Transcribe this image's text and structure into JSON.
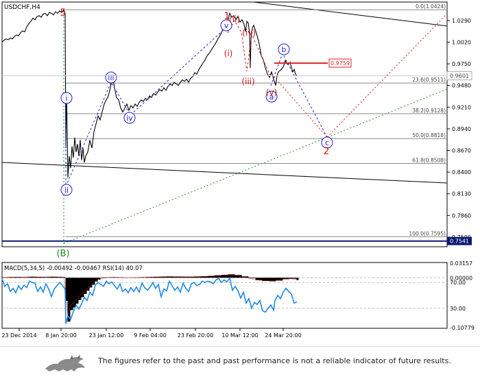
{
  "header": {
    "symbol_label": "USDCHF,H4"
  },
  "indicator": {
    "label": "MACD(5,34,5) -0.00492 -0.00467 RSI(14) 40.07"
  },
  "disclaimer": "The figures refer to the past and past performance is not a reliable indicator of future results.",
  "colors": {
    "price_line": "#000000",
    "wave_blue": "#1f1fcc",
    "wave_red": "#cc1414",
    "wave_green": "#228822",
    "level_line": "#888888",
    "current_price_bg": "#0a1a70",
    "target_line": "#e02020",
    "rsi_line": "#1e88e5",
    "histogram": "#000000"
  },
  "chart_data": {
    "type": "line",
    "symbol": "USDCHF",
    "timeframe": "H4",
    "x_labels": [
      "23 Dec 2014",
      "8 Jan 20:00",
      "23 Jan 12:00",
      "9 Feb 04:00",
      "23 Feb 20:00",
      "10 Mar 12:00",
      "24 Mar 20:00"
    ],
    "y_ticks": [
      "1.0290",
      "1.0020",
      "0.9750",
      "0.9480",
      "0.9210",
      "0.8940",
      "0.8670",
      "0.8400",
      "0.8130",
      "0.7860",
      "0.7590"
    ],
    "ylim": [
      0.747,
      1.052
    ],
    "current_price": "0.9601",
    "base_level": "0.7541",
    "target_label": "0.9759",
    "fib_levels": [
      {
        "label": "0.0(1.0424)",
        "price": 1.0424
      },
      {
        "label": "23.6(0.9511)",
        "price": 0.9511
      },
      {
        "label": "38.2(0.9128)",
        "price": 0.9128
      },
      {
        "label": "50.0(0.8818)",
        "price": 0.8818
      },
      {
        "label": "61.8(0.8508)",
        "price": 0.8508
      },
      {
        "label": "100.0(0.7595)",
        "price": 0.7595
      }
    ],
    "wave_labels_blue": [
      "i",
      "ii",
      "iii",
      "iv",
      "v",
      "b",
      "c",
      "a"
    ],
    "wave_labels_red": [
      "5",
      "1",
      "(ii)",
      "(iv)",
      "(i)",
      "(iii)",
      "(v)",
      "2"
    ],
    "wave_labels_green": [
      "(B)"
    ],
    "price_series": [
      [
        0,
        1.0021
      ],
      [
        3,
        1.0045
      ],
      [
        6,
        1.006
      ],
      [
        9,
        1.005
      ],
      [
        12,
        1.0072
      ],
      [
        15,
        1.006
      ],
      [
        18,
        1.009
      ],
      [
        21,
        1.011
      ],
      [
        24,
        1.0098
      ],
      [
        27,
        1.014
      ],
      [
        30,
        1.016
      ],
      [
        33,
        1.015
      ],
      [
        36,
        1.021
      ],
      [
        39,
        1.025
      ],
      [
        42,
        1.028
      ],
      [
        45,
        1.032
      ],
      [
        48,
        1.03
      ],
      [
        51,
        1.034
      ],
      [
        54,
        1.035
      ],
      [
        57,
        1.033
      ],
      [
        60,
        1.037
      ],
      [
        63,
        1.038
      ],
      [
        66,
        1.035
      ],
      [
        69,
        1.039
      ],
      [
        72,
        1.038
      ],
      [
        75,
        1.036
      ],
      [
        78,
        1.04
      ],
      [
        81,
        1.038
      ],
      [
        84,
        1.041
      ],
      [
        87,
        1.039
      ],
      [
        90,
        1.0424
      ],
      [
        92,
        1.038
      ],
      [
        93,
        0.87
      ],
      [
        94,
        0.94
      ],
      [
        95,
        0.89
      ],
      [
        96,
        0.833
      ],
      [
        98,
        0.86
      ],
      [
        100,
        0.845
      ],
      [
        102,
        0.872
      ],
      [
        104,
        0.858
      ],
      [
        106,
        0.883
      ],
      [
        108,
        0.865
      ],
      [
        110,
        0.875
      ],
      [
        112,
        0.86
      ],
      [
        114,
        0.88
      ],
      [
        116,
        0.855
      ],
      [
        118,
        0.87
      ],
      [
        120,
        0.852
      ],
      [
        122,
        0.86
      ],
      [
        125,
        0.865
      ],
      [
        128,
        0.88
      ],
      [
        131,
        0.87
      ],
      [
        134,
        0.89
      ],
      [
        137,
        0.9
      ],
      [
        140,
        0.91
      ],
      [
        143,
        0.905
      ],
      [
        146,
        0.915
      ],
      [
        149,
        0.925
      ],
      [
        152,
        0.93
      ],
      [
        155,
        0.935
      ],
      [
        158,
        0.945
      ],
      [
        161,
        0.96
      ],
      [
        164,
        0.945
      ],
      [
        167,
        0.933
      ],
      [
        170,
        0.93
      ],
      [
        173,
        0.92
      ],
      [
        176,
        0.915
      ],
      [
        179,
        0.92
      ],
      [
        182,
        0.925
      ],
      [
        185,
        0.917
      ],
      [
        188,
        0.923
      ],
      [
        191,
        0.92
      ],
      [
        194,
        0.925
      ],
      [
        197,
        0.922
      ],
      [
        200,
        0.927
      ],
      [
        203,
        0.93
      ],
      [
        206,
        0.928
      ],
      [
        209,
        0.932
      ],
      [
        212,
        0.93
      ],
      [
        215,
        0.935
      ],
      [
        218,
        0.933
      ],
      [
        221,
        0.938
      ],
      [
        224,
        0.936
      ],
      [
        227,
        0.94
      ],
      [
        230,
        0.943
      ],
      [
        233,
        0.941
      ],
      [
        236,
        0.945
      ],
      [
        239,
        0.942
      ],
      [
        242,
        0.947
      ],
      [
        245,
        0.95
      ],
      [
        248,
        0.948
      ],
      [
        251,
        0.952
      ],
      [
        254,
        0.95
      ],
      [
        257,
        0.948
      ],
      [
        260,
        0.952
      ],
      [
        263,
        0.955
      ],
      [
        266,
        0.953
      ],
      [
        269,
        0.956
      ],
      [
        272,
        0.952
      ],
      [
        275,
        0.957
      ],
      [
        278,
        0.959
      ],
      [
        281,
        0.964
      ],
      [
        284,
        0.962
      ],
      [
        287,
        0.968
      ],
      [
        290,
        0.972
      ],
      [
        293,
        0.976
      ],
      [
        296,
        0.98
      ],
      [
        299,
        0.985
      ],
      [
        302,
        0.988
      ],
      [
        305,
        0.992
      ],
      [
        308,
        0.996
      ],
      [
        311,
        1.0
      ],
      [
        314,
        1.005
      ],
      [
        317,
        1.009
      ],
      [
        320,
        1.014
      ],
      [
        323,
        1.02
      ],
      [
        326,
        1.025
      ],
      [
        329,
        1.028
      ],
      [
        332,
        1.038
      ],
      [
        335,
        1.033
      ],
      [
        338,
        1.035
      ],
      [
        341,
        1.03
      ],
      [
        344,
        1.034
      ],
      [
        347,
        1.027
      ],
      [
        350,
        1.03
      ],
      [
        353,
        1.024
      ],
      [
        355,
        1.015
      ],
      [
        357,
        1.028
      ],
      [
        359,
        1.026
      ],
      [
        361,
        1.013
      ],
      [
        362,
        0.97
      ],
      [
        363,
        1.005
      ],
      [
        365,
        1.02
      ],
      [
        367,
        1.023
      ],
      [
        369,
        1.018
      ],
      [
        372,
        1.01
      ],
      [
        375,
        1.0
      ],
      [
        378,
        0.985
      ],
      [
        381,
        0.98
      ],
      [
        384,
        0.97
      ],
      [
        387,
        0.962
      ],
      [
        390,
        0.958
      ],
      [
        393,
        0.965
      ],
      [
        396,
        0.956
      ],
      [
        399,
        0.948
      ],
      [
        401,
        0.96
      ],
      [
        403,
        0.965
      ],
      [
        406,
        0.967
      ],
      [
        409,
        0.97
      ],
      [
        411,
        0.973
      ],
      [
        413,
        0.979
      ],
      [
        415,
        0.976
      ],
      [
        417,
        0.974
      ],
      [
        420,
        0.977
      ],
      [
        422,
        0.97
      ],
      [
        424,
        0.965
      ],
      [
        426,
        0.968
      ],
      [
        428,
        0.962
      ],
      [
        430,
        0.9601
      ]
    ],
    "rsi_series": [
      [
        0,
        76
      ],
      [
        4,
        64
      ],
      [
        8,
        68
      ],
      [
        12,
        56
      ],
      [
        16,
        61
      ],
      [
        20,
        54
      ],
      [
        24,
        65
      ],
      [
        28,
        59
      ],
      [
        32,
        66
      ],
      [
        36,
        62
      ],
      [
        40,
        72
      ],
      [
        44,
        70
      ],
      [
        48,
        69
      ],
      [
        52,
        56
      ],
      [
        56,
        63
      ],
      [
        60,
        55
      ],
      [
        64,
        68
      ],
      [
        68,
        60
      ],
      [
        72,
        48
      ],
      [
        76,
        60
      ],
      [
        80,
        65
      ],
      [
        84,
        70
      ],
      [
        88,
        66
      ],
      [
        92,
        59
      ],
      [
        93,
        6
      ],
      [
        96,
        18
      ],
      [
        100,
        13
      ],
      [
        104,
        25
      ],
      [
        108,
        35
      ],
      [
        112,
        29
      ],
      [
        116,
        37
      ],
      [
        120,
        47
      ],
      [
        124,
        42
      ],
      [
        128,
        55
      ],
      [
        132,
        50
      ],
      [
        136,
        66
      ],
      [
        140,
        70
      ],
      [
        144,
        67
      ],
      [
        148,
        64
      ],
      [
        152,
        72
      ],
      [
        156,
        68
      ],
      [
        160,
        71
      ],
      [
        164,
        65
      ],
      [
        168,
        60
      ],
      [
        172,
        68
      ],
      [
        176,
        56
      ],
      [
        180,
        60
      ],
      [
        184,
        54
      ],
      [
        188,
        62
      ],
      [
        192,
        56
      ],
      [
        196,
        63
      ],
      [
        200,
        55
      ],
      [
        204,
        69
      ],
      [
        208,
        62
      ],
      [
        212,
        58
      ],
      [
        216,
        63
      ],
      [
        220,
        70
      ],
      [
        224,
        61
      ],
      [
        228,
        67
      ],
      [
        232,
        48
      ],
      [
        236,
        60
      ],
      [
        240,
        57
      ],
      [
        244,
        72
      ],
      [
        248,
        65
      ],
      [
        252,
        58
      ],
      [
        256,
        63
      ],
      [
        260,
        55
      ],
      [
        264,
        69
      ],
      [
        268,
        61
      ],
      [
        272,
        56
      ],
      [
        276,
        68
      ],
      [
        280,
        70
      ],
      [
        284,
        65
      ],
      [
        288,
        67
      ],
      [
        292,
        72
      ],
      [
        296,
        70
      ],
      [
        300,
        72
      ],
      [
        304,
        71
      ],
      [
        308,
        68
      ],
      [
        312,
        74
      ],
      [
        316,
        76
      ],
      [
        320,
        70
      ],
      [
        324,
        74
      ],
      [
        328,
        71
      ],
      [
        332,
        77
      ],
      [
        336,
        58
      ],
      [
        340,
        64
      ],
      [
        344,
        57
      ],
      [
        348,
        46
      ],
      [
        352,
        55
      ],
      [
        356,
        38
      ],
      [
        360,
        45
      ],
      [
        364,
        30
      ],
      [
        368,
        39
      ],
      [
        372,
        36
      ],
      [
        376,
        42
      ],
      [
        380,
        26
      ],
      [
        384,
        24
      ],
      [
        388,
        30
      ],
      [
        392,
        35
      ],
      [
        396,
        27
      ],
      [
        398,
        42
      ],
      [
        402,
        50
      ],
      [
        406,
        45
      ],
      [
        410,
        55
      ],
      [
        414,
        61
      ],
      [
        418,
        56
      ],
      [
        422,
        52
      ],
      [
        426,
        38
      ],
      [
        430,
        40
      ]
    ],
    "macd_histogram": [
      [
        0,
        0.001
      ],
      [
        10,
        0.0015
      ],
      [
        20,
        0.0018
      ],
      [
        30,
        0.0014
      ],
      [
        40,
        0.0022
      ],
      [
        50,
        0.002
      ],
      [
        60,
        0.0018
      ],
      [
        70,
        0.0022
      ],
      [
        80,
        0.002
      ],
      [
        90,
        0.0016
      ],
      [
        93,
        -0.05
      ],
      [
        96,
        -0.095
      ],
      [
        100,
        -0.07
      ],
      [
        104,
        -0.064
      ],
      [
        108,
        -0.056
      ],
      [
        112,
        -0.048
      ],
      [
        116,
        -0.042
      ],
      [
        120,
        -0.035
      ],
      [
        124,
        -0.028
      ],
      [
        128,
        -0.021
      ],
      [
        132,
        -0.015
      ],
      [
        136,
        -0.008
      ],
      [
        140,
        -0.004
      ],
      [
        144,
        -0.001
      ],
      [
        150,
        0.0008
      ],
      [
        160,
        0.0012
      ],
      [
        170,
        0.0008
      ],
      [
        180,
        0.0004
      ],
      [
        190,
        0.0006
      ],
      [
        200,
        0.001
      ],
      [
        210,
        0.0016
      ],
      [
        220,
        0.002
      ],
      [
        230,
        0.0024
      ],
      [
        240,
        0.0028
      ],
      [
        250,
        0.0026
      ],
      [
        260,
        0.0024
      ],
      [
        270,
        0.0022
      ],
      [
        280,
        0.0026
      ],
      [
        290,
        0.0032
      ],
      [
        300,
        0.004
      ],
      [
        310,
        0.0052
      ],
      [
        320,
        0.0064
      ],
      [
        330,
        0.0074
      ],
      [
        340,
        0.006
      ],
      [
        350,
        0.003
      ],
      [
        360,
        -0.001
      ],
      [
        370,
        -0.005
      ],
      [
        380,
        -0.007
      ],
      [
        390,
        -0.0076
      ],
      [
        400,
        -0.006
      ],
      [
        410,
        -0.003
      ],
      [
        420,
        -0.002
      ],
      [
        430,
        -0.0049
      ]
    ],
    "rsi_ticks": [
      "70.00",
      "30.00"
    ],
    "macd_ticks": [
      "0.03157",
      "0.00000",
      "-0.10779"
    ]
  }
}
